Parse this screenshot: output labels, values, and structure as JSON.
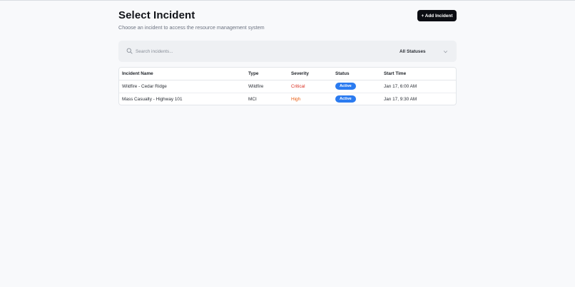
{
  "header": {
    "title": "Select Incident",
    "subtitle": "Choose an incident to access the resource management system",
    "add_button_label": "+ Add Incident"
  },
  "filters": {
    "search_placeholder": "Search incidents...",
    "status_selected": "All Statuses"
  },
  "table": {
    "columns": [
      "Incident Name",
      "Type",
      "Severity",
      "Status",
      "Start Time"
    ],
    "rows": [
      {
        "name": "Wildfire - Cedar Ridge",
        "type": "Wildfire",
        "severity": "Critical",
        "status": "Active",
        "start": "Jan 17, 6:00 AM"
      },
      {
        "name": "Mass Casualty - Highway 101",
        "type": "MCI",
        "severity": "High",
        "status": "Active",
        "start": "Jan 17, 9:30 AM"
      }
    ]
  },
  "colors": {
    "primary_button": "#0b0d12",
    "critical": "#d92d20",
    "high": "#e8590c",
    "active_badge": "#2b7bf0"
  }
}
